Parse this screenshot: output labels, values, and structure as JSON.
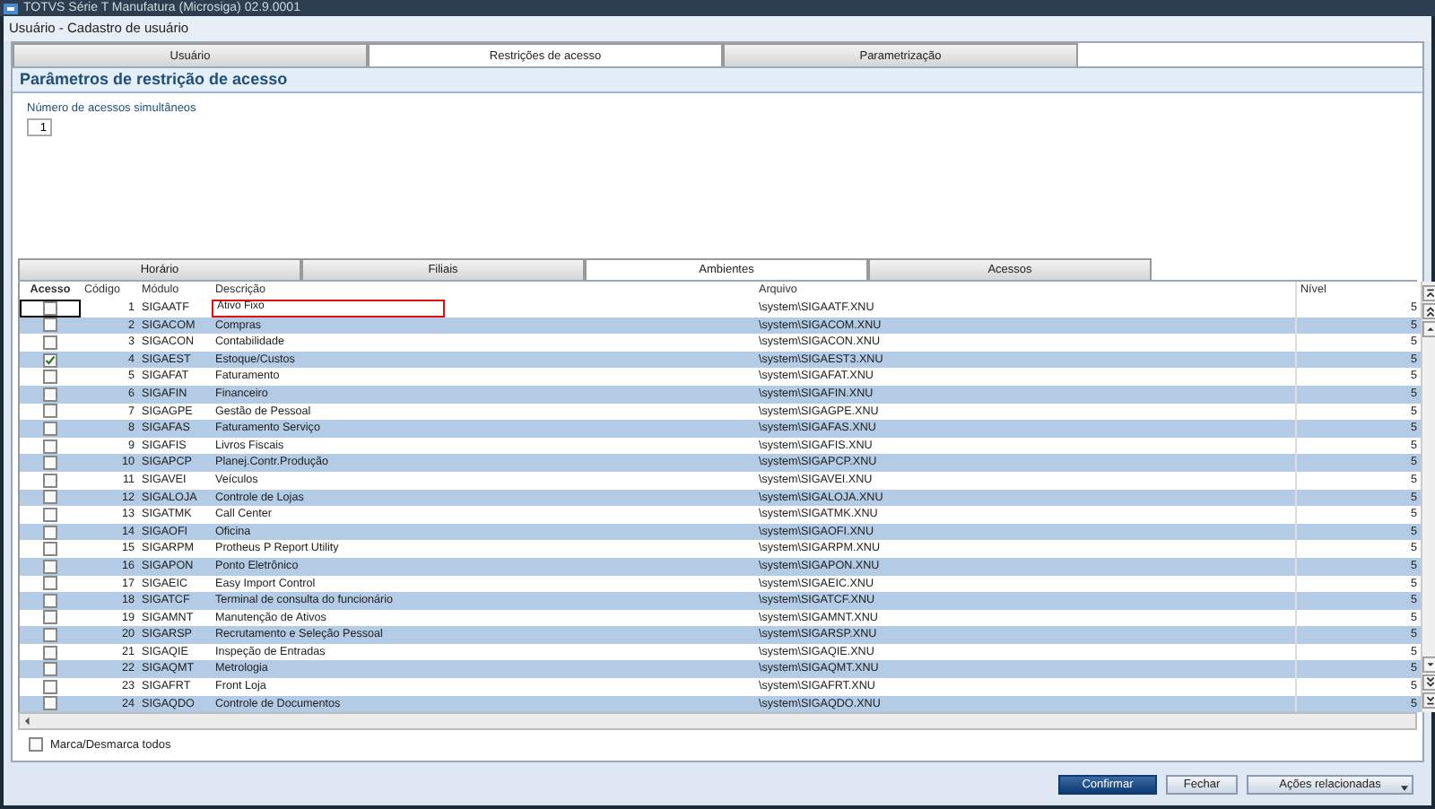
{
  "window": {
    "title": "TOTVS Série T Manufatura (Microsiga) 02.9.0001"
  },
  "dialog": {
    "title": "Usuário - Cadastro de usuário"
  },
  "tabs": [
    {
      "label": "Usuário",
      "selected": false
    },
    {
      "label": "Restrições de acesso",
      "selected": true
    },
    {
      "label": "Parametrização",
      "selected": false
    }
  ],
  "section": {
    "title": "Parâmetros de restrição de acesso"
  },
  "simultaneous_access": {
    "label": "Número de acessos simultâneos",
    "value": "1"
  },
  "subtabs": [
    {
      "label": "Horário",
      "selected": false
    },
    {
      "label": "Filiais",
      "selected": false
    },
    {
      "label": "Ambientes",
      "selected": true
    },
    {
      "label": "Acessos",
      "selected": false
    }
  ],
  "table": {
    "columns": [
      "Acesso",
      "Código",
      "Módulo",
      "Descrição",
      "Arquivo",
      "Nível"
    ],
    "rows": [
      {
        "checked": false,
        "focused": true,
        "code": "1",
        "module": "SIGAATF",
        "description": "Ativo Fixo",
        "file": "\\system\\SIGAATF.XNU",
        "level": "5"
      },
      {
        "checked": false,
        "focused": false,
        "code": "2",
        "module": "SIGACOM",
        "description": "Compras",
        "file": "\\system\\SIGACOM.XNU",
        "level": "5"
      },
      {
        "checked": false,
        "focused": false,
        "code": "3",
        "module": "SIGACON",
        "description": "Contabilidade",
        "file": "\\system\\SIGACON.XNU",
        "level": "5"
      },
      {
        "checked": true,
        "focused": false,
        "code": "4",
        "module": "SIGAEST",
        "description": "Estoque/Custos",
        "file": "\\system\\SIGAEST3.XNU",
        "level": "5"
      },
      {
        "checked": false,
        "focused": false,
        "code": "5",
        "module": "SIGAFAT",
        "description": "Faturamento",
        "file": "\\system\\SIGAFAT.XNU",
        "level": "5"
      },
      {
        "checked": false,
        "focused": false,
        "code": "6",
        "module": "SIGAFIN",
        "description": "Financeiro",
        "file": "\\system\\SIGAFIN.XNU",
        "level": "5"
      },
      {
        "checked": false,
        "focused": false,
        "code": "7",
        "module": "SIGAGPE",
        "description": "Gestão de Pessoal",
        "file": "\\system\\SIGAGPE.XNU",
        "level": "5"
      },
      {
        "checked": false,
        "focused": false,
        "code": "8",
        "module": "SIGAFAS",
        "description": "Faturamento Serviço",
        "file": "\\system\\SIGAFAS.XNU",
        "level": "5"
      },
      {
        "checked": false,
        "focused": false,
        "code": "9",
        "module": "SIGAFIS",
        "description": "Livros Fiscais",
        "file": "\\system\\SIGAFIS.XNU",
        "level": "5"
      },
      {
        "checked": false,
        "focused": false,
        "code": "10",
        "module": "SIGAPCP",
        "description": "Planej.Contr.Produção",
        "file": "\\system\\SIGAPCP.XNU",
        "level": "5"
      },
      {
        "checked": false,
        "focused": false,
        "code": "11",
        "module": "SIGAVEI",
        "description": "Veículos",
        "file": "\\system\\SIGAVEI.XNU",
        "level": "5"
      },
      {
        "checked": false,
        "focused": false,
        "code": "12",
        "module": "SIGALOJA",
        "description": "Controle de Lojas",
        "file": "\\system\\SIGALOJA.XNU",
        "level": "5"
      },
      {
        "checked": false,
        "focused": false,
        "code": "13",
        "module": "SIGATMK",
        "description": "Call Center",
        "file": "\\system\\SIGATMK.XNU",
        "level": "5"
      },
      {
        "checked": false,
        "focused": false,
        "code": "14",
        "module": "SIGAOFI",
        "description": "Oficina",
        "file": "\\system\\SIGAOFI.XNU",
        "level": "5"
      },
      {
        "checked": false,
        "focused": false,
        "code": "15",
        "module": "SIGARPM",
        "description": "Protheus P Report Utility",
        "file": "\\system\\SIGARPM.XNU",
        "level": "5"
      },
      {
        "checked": false,
        "focused": false,
        "code": "16",
        "module": "SIGAPON",
        "description": "Ponto Eletrônico",
        "file": "\\system\\SIGAPON.XNU",
        "level": "5"
      },
      {
        "checked": false,
        "focused": false,
        "code": "17",
        "module": "SIGAEIC",
        "description": "Easy Import Control",
        "file": "\\system\\SIGAEIC.XNU",
        "level": "5"
      },
      {
        "checked": false,
        "focused": false,
        "code": "18",
        "module": "SIGATCF",
        "description": "Terminal de consulta do funcionário",
        "file": "\\system\\SIGATCF.XNU",
        "level": "5"
      },
      {
        "checked": false,
        "focused": false,
        "code": "19",
        "module": "SIGAMNT",
        "description": "Manutenção de Ativos",
        "file": "\\system\\SIGAMNT.XNU",
        "level": "5"
      },
      {
        "checked": false,
        "focused": false,
        "code": "20",
        "module": "SIGARSP",
        "description": "Recrutamento e Seleção Pessoal",
        "file": "\\system\\SIGARSP.XNU",
        "level": "5"
      },
      {
        "checked": false,
        "focused": false,
        "code": "21",
        "module": "SIGAQIE",
        "description": "Inspeção de Entradas",
        "file": "\\system\\SIGAQIE.XNU",
        "level": "5"
      },
      {
        "checked": false,
        "focused": false,
        "code": "22",
        "module": "SIGAQMT",
        "description": "Metrologia",
        "file": "\\system\\SIGAQMT.XNU",
        "level": "5"
      },
      {
        "checked": false,
        "focused": false,
        "code": "23",
        "module": "SIGAFRT",
        "description": "Front Loja",
        "file": "\\system\\SIGAFRT.XNU",
        "level": "5"
      },
      {
        "checked": false,
        "focused": false,
        "code": "24",
        "module": "SIGAQDO",
        "description": "Controle de Documentos",
        "file": "\\system\\SIGAQDO.XNU",
        "level": "5"
      }
    ]
  },
  "select_all": {
    "label": "Marca/Desmarca todos",
    "checked": false
  },
  "buttons": [
    {
      "label": "Confirmar",
      "kind": "primary"
    },
    {
      "label": "Fechar",
      "kind": "normal"
    },
    {
      "label": "Ações relacionadas",
      "kind": "menu"
    }
  ]
}
